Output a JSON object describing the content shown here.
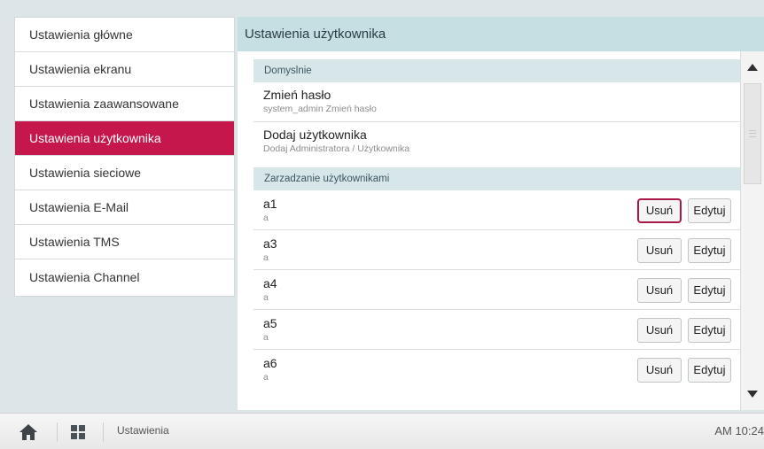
{
  "sidebar": {
    "items": [
      {
        "label": "Ustawienia główne"
      },
      {
        "label": "Ustawienia ekranu"
      },
      {
        "label": "Ustawienia zaawansowane"
      },
      {
        "label": "Ustawienia użytkownika",
        "active": true
      },
      {
        "label": "Ustawienia sieciowe"
      },
      {
        "label": "Ustawienia E-Mail"
      },
      {
        "label": "Ustawienia TMS"
      },
      {
        "label": "Ustawienia Channel"
      }
    ]
  },
  "main": {
    "title": "Ustawienia użytkownika",
    "default_section": {
      "header": "Domyslnie",
      "items": [
        {
          "title": "Zmień hasło",
          "subtitle": "system_admin Zmień hasło"
        },
        {
          "title": "Dodaj użytkownika",
          "subtitle": "Dodaj Administratora / Użytkownika"
        }
      ]
    },
    "users_section": {
      "header": "Zarzadzanie użytkownikami",
      "delete_label": "Usuń",
      "edit_label": "Edytuj",
      "users": [
        {
          "name": "a1",
          "subtitle": "a"
        },
        {
          "name": "a3",
          "subtitle": "a"
        },
        {
          "name": "a4",
          "subtitle": "a"
        },
        {
          "name": "a5",
          "subtitle": "a"
        },
        {
          "name": "a6",
          "subtitle": "a"
        }
      ]
    }
  },
  "scrollbar": {
    "up_icon": "triangle-up-icon",
    "down_icon": "triangle-down-icon"
  },
  "bottombar": {
    "home_icon": "home-icon",
    "apps_icon": "grid-icon",
    "breadcrumb": "Ustawienia",
    "clock": "AM 10:24"
  },
  "colors": {
    "accent": "#c6174d",
    "header_bg": "#c5dfe3",
    "section_bg": "#d6e6e9",
    "page_bg": "#dce6e9"
  }
}
